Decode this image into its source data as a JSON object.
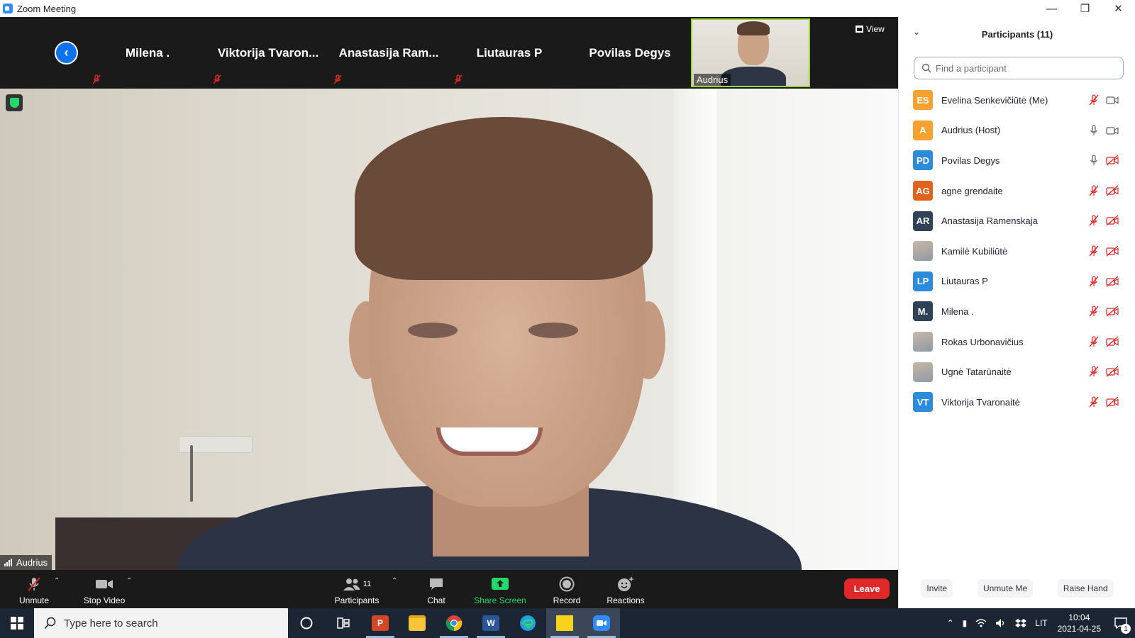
{
  "window": {
    "title": "Zoom Meeting",
    "controls": [
      "minimize",
      "restore",
      "close"
    ]
  },
  "strip": {
    "thumbnails": [
      {
        "name": "Milena .",
        "muted": true
      },
      {
        "name": "Viktorija  Tvaron...",
        "muted": true
      },
      {
        "name": "Anastasija  Ram...",
        "muted": true
      },
      {
        "name": "Liutauras P",
        "muted": true
      },
      {
        "name": "Povilas Degys",
        "muted": false
      }
    ],
    "video_thumbnail": {
      "name": "Audrius"
    },
    "view_label": "View"
  },
  "main_video": {
    "speaker_name": "Audrius"
  },
  "toolbar": {
    "unmute": "Unmute",
    "stop_video": "Stop Video",
    "participants": "Participants",
    "participants_count": "11",
    "chat": "Chat",
    "share_screen": "Share Screen",
    "record": "Record",
    "reactions": "Reactions",
    "leave": "Leave"
  },
  "panel": {
    "title": "Participants (11)",
    "search_placeholder": "Find a participant",
    "participants": [
      {
        "initials": "ES",
        "name": "Evelina Senkevičiūtė (Me)",
        "color": "#f7a130",
        "mic": "muted",
        "cam": "on"
      },
      {
        "initials": "A",
        "name": "Audrius (Host)",
        "color": "#f7a130",
        "mic": "on",
        "cam": "on"
      },
      {
        "initials": "PD",
        "name": "Povilas Degys",
        "color": "#2d8cda",
        "mic": "on",
        "cam": "off"
      },
      {
        "initials": "AG",
        "name": "agne grendaite",
        "color": "#e2631e",
        "mic": "muted",
        "cam": "off"
      },
      {
        "initials": "AR",
        "name": "Anastasija Ramenskaja",
        "color": "#2f4258",
        "mic": "muted",
        "cam": "off"
      },
      {
        "initials": "",
        "name": "Kamilė Kubiliūtė",
        "color": "photo",
        "mic": "muted",
        "cam": "off"
      },
      {
        "initials": "LP",
        "name": "Liutauras P",
        "color": "#2d8cda",
        "mic": "muted",
        "cam": "off"
      },
      {
        "initials": "M.",
        "name": "Milena .",
        "color": "#2f4258",
        "mic": "muted",
        "cam": "off"
      },
      {
        "initials": "",
        "name": "Rokas Urbonavičius",
        "color": "photo",
        "mic": "muted",
        "cam": "off"
      },
      {
        "initials": "",
        "name": "Ugnė Tatarūnaitė",
        "color": "photo",
        "mic": "muted",
        "cam": "off"
      },
      {
        "initials": "VT",
        "name": "Viktorija Tvaronaitė",
        "color": "#2d8cda",
        "mic": "muted",
        "cam": "off"
      }
    ],
    "footer": {
      "invite": "Invite",
      "unmute_me": "Unmute Me",
      "raise_hand": "Raise Hand"
    }
  },
  "taskbar": {
    "search_placeholder": "Type here to search",
    "apps": [
      "cortana",
      "task-view",
      "powerpoint",
      "file-explorer",
      "chrome",
      "word",
      "edge",
      "sticky-notes",
      "zoom"
    ],
    "language": "LIT",
    "time": "10:04",
    "date": "2021-04-25",
    "notifications": "1"
  },
  "colors": {
    "zoom_blue": "#2d8cff",
    "leave_red": "#e02828",
    "share_green": "#23d96b",
    "muted_red": "#e02828"
  }
}
